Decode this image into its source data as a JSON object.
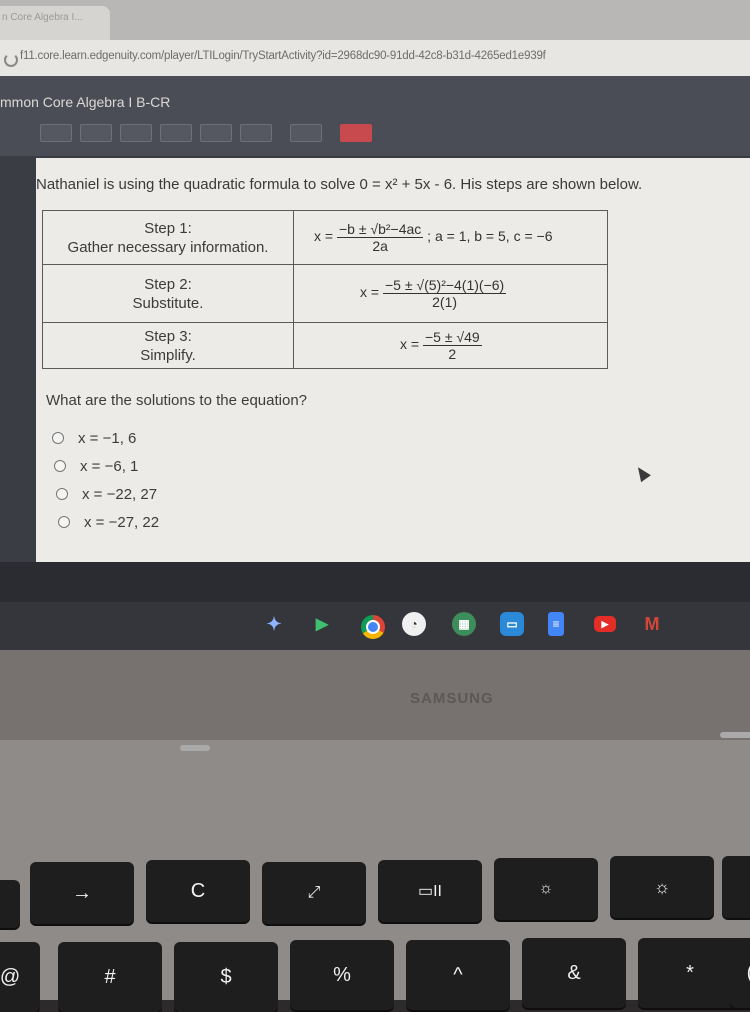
{
  "browser": {
    "tab_title": "n Core Algebra I...",
    "url": "f11.core.learn.edgenuity.com/player/LTILogin/TryStartActivity?id=2968dc90-91dd-42c8-b31d-4265ed1e939f"
  },
  "app": {
    "course_title": "mmon Core Algebra I B-CR"
  },
  "question": {
    "stem": "Nathaniel is using the quadratic formula to solve 0 = x² + 5x - 6. His steps are shown below.",
    "steps": [
      {
        "title": "Step 1:",
        "subtitle": "Gather necessary information.",
        "lhs": "x =",
        "numerator": "−b ± √b²−4ac",
        "denominator": "2a",
        "extra": "; a = 1, b = 5, c = −6"
      },
      {
        "title": "Step 2:",
        "subtitle": "Substitute.",
        "lhs": "x =",
        "numerator": "−5 ± √(5)²−4(1)(−6)",
        "denominator": "2(1)",
        "extra": ""
      },
      {
        "title": "Step 3:",
        "subtitle": "Simplify.",
        "lhs": "x =",
        "numerator": "−5 ± √49",
        "denominator": "2",
        "extra": ""
      }
    ],
    "prompt": "What are the solutions to the equation?",
    "options": [
      "x = −1, 6",
      "x = −6, 1",
      "x = −22, 27",
      "x = −27, 22"
    ]
  },
  "shelf": {
    "icons": [
      "launcher-icon",
      "play-store-icon",
      "chrome-icon",
      "signal-icon",
      "apps-icon",
      "files-icon",
      "docs-icon",
      "youtube-icon",
      "gmail-icon"
    ],
    "gmail_label": "M"
  },
  "laptop": {
    "brand": "SAMSUNG",
    "keys_row1": [
      "→",
      "C",
      "⤢",
      "▭II",
      "☼",
      "☼"
    ],
    "keys_row2": [
      "@",
      "#",
      "$",
      "%",
      "^",
      "&",
      "*",
      "("
    ]
  },
  "colors": {
    "content_bg": "#ecebe8",
    "header_bg": "#4a4d55",
    "gmail_red": "#d44638",
    "youtube_red": "#e52d27"
  }
}
